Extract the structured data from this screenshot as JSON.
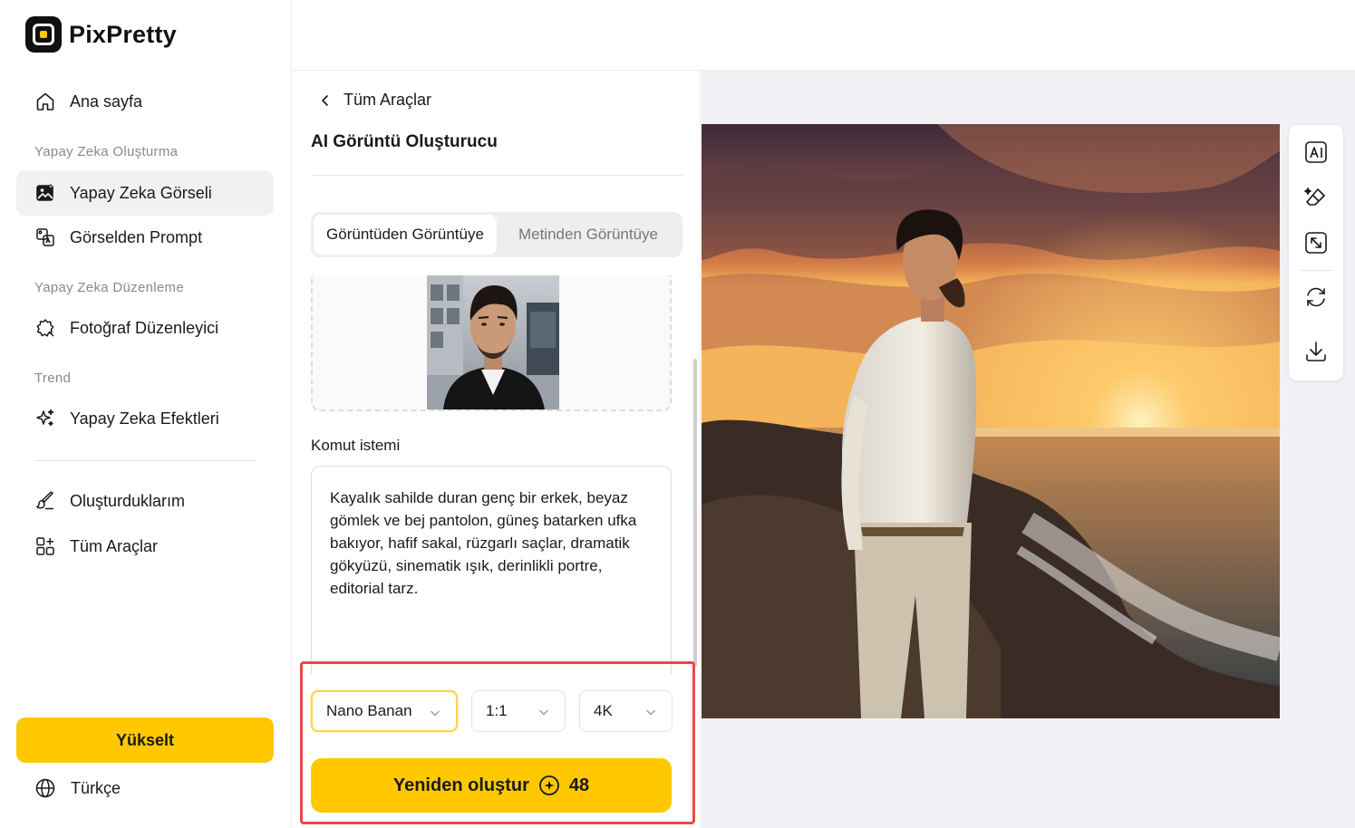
{
  "brand": {
    "name": "PixPretty",
    "accent": "#ffc800"
  },
  "sidebar": {
    "home": {
      "label": "Ana sayfa",
      "icon": "home-icon"
    },
    "section_create": "Yapay Zeka Oluşturma",
    "ai_image": {
      "label": "Yapay Zeka Görseli",
      "icon": "ai-image-icon"
    },
    "image_to_prompt": {
      "label": "Görselden Prompt",
      "icon": "image-prompt-icon"
    },
    "section_edit": "Yapay Zeka Düzenleme",
    "photo_editor": {
      "label": "Fotoğraf Düzenleyici",
      "icon": "photo-editor-icon"
    },
    "section_trend": "Trend",
    "ai_effects": {
      "label": "Yapay Zeka Efektleri",
      "icon": "sparkle-icon"
    },
    "my_creations": {
      "label": "Oluşturduklarım",
      "icon": "brush-icon"
    },
    "all_tools": {
      "label": "Tüm Araçlar",
      "icon": "grid-icon"
    },
    "upgrade_label": "Yükselt",
    "language": "Türkçe"
  },
  "panel": {
    "back_label": "Tüm Araçlar",
    "title": "AI Görüntü Oluşturucu",
    "tabs": [
      "Görüntüden Görüntüye",
      "Metinden Görüntüye"
    ],
    "active_tab": "Görüntüden Görüntüye",
    "prompt_label": "Komut istemi",
    "prompt_text": "Kayalık sahilde duran genç bir erkek, beyaz gömlek ve bej pantolon, güneş batarken ufka bakıyor, hafif sakal, rüzgarlı saçlar, dramatik gökyüzü, sinematik ışık, derinlikli portre, editorial tarz.",
    "model": "Nano Banan",
    "ratio": "1:1",
    "resolution": "4K",
    "regenerate_label": "Yeniden oluştur",
    "credits": "48"
  },
  "toolbar": [
    "ai-text-icon",
    "eraser-icon",
    "resize-icon",
    "refresh-icon",
    "download-icon"
  ]
}
